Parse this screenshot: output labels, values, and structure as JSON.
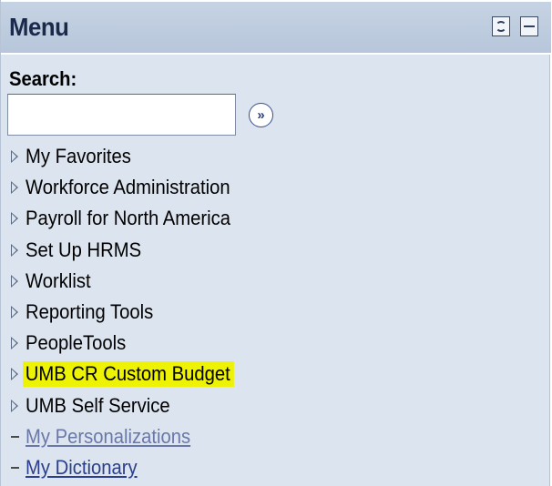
{
  "header": {
    "title": "Menu",
    "refresh_icon": "refresh-icon",
    "minimize_icon": "minimize-icon"
  },
  "search": {
    "label": "Search:",
    "value": "",
    "placeholder": "",
    "go_icon": "double-chevron-right-icon"
  },
  "menu": {
    "items": [
      {
        "label": "My Favorites",
        "type": "folder"
      },
      {
        "label": "Workforce Administration",
        "type": "folder"
      },
      {
        "label": "Payroll for North America",
        "type": "folder"
      },
      {
        "label": "Set Up HRMS",
        "type": "folder"
      },
      {
        "label": "Worklist",
        "type": "folder"
      },
      {
        "label": "Reporting Tools",
        "type": "folder"
      },
      {
        "label": "PeopleTools",
        "type": "folder"
      },
      {
        "label": "UMB CR Custom Budget",
        "type": "folder",
        "highlighted": true
      },
      {
        "label": "UMB Self Service",
        "type": "folder"
      },
      {
        "label": "My Personalizations",
        "type": "link"
      },
      {
        "label": "My Dictionary",
        "type": "link"
      }
    ]
  },
  "colors": {
    "panel_background": "#dce4ef",
    "header_background": "#c6d3e4",
    "highlight": "#eef204",
    "link": "#2b3e8a"
  }
}
